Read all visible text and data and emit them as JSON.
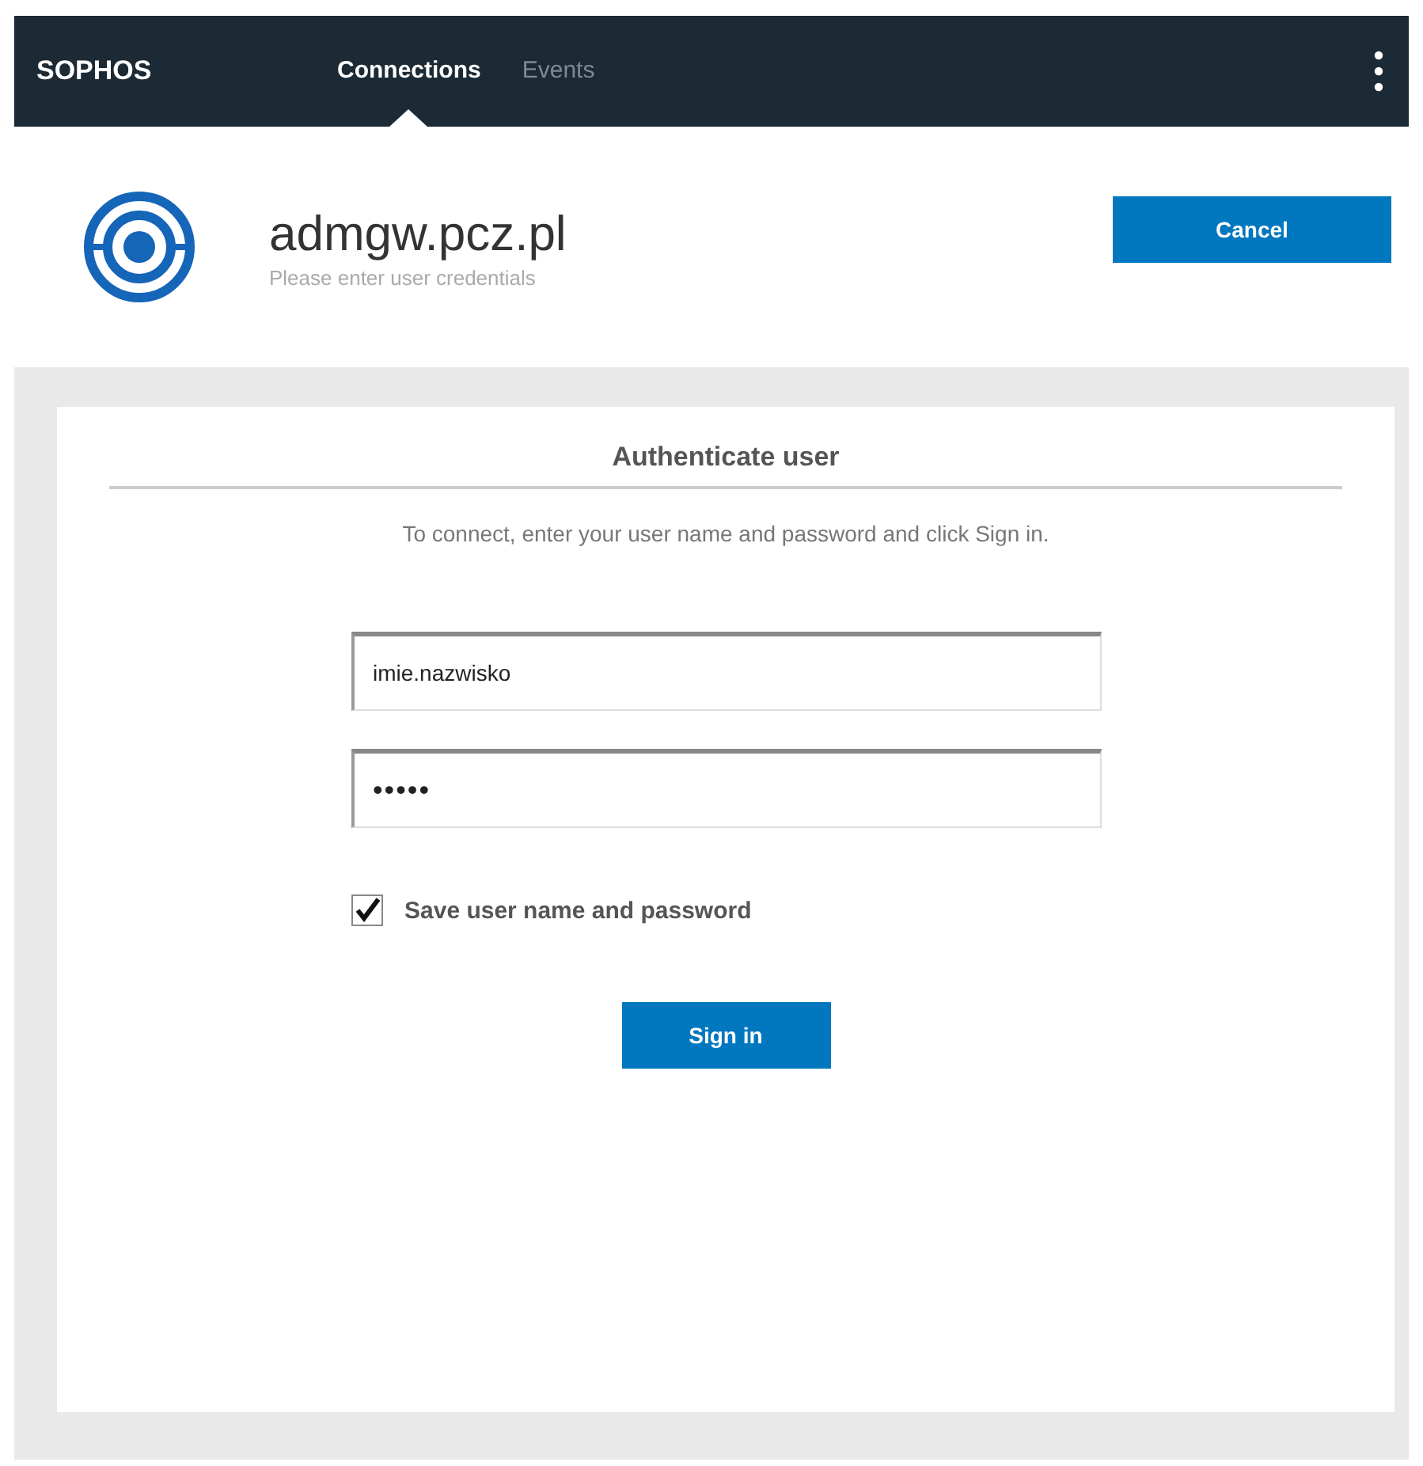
{
  "navbar": {
    "brand": "SOPHOS",
    "tabs": [
      {
        "label": "Connections",
        "selected": true
      },
      {
        "label": "Events",
        "selected": false
      }
    ]
  },
  "header": {
    "title": "admgw.pcz.pl",
    "subtitle": "Please enter user credentials",
    "cancel_button": "Cancel"
  },
  "form": {
    "heading": "Authenticate user",
    "instructions": "To connect, enter your user name and password and click Sign in.",
    "username": {
      "value": "imie.nazwisko"
    },
    "password": {
      "value": "•••••"
    },
    "save_credentials": {
      "label": "Save user name and password",
      "checked": true
    },
    "sign_in_button": "Sign in"
  }
}
